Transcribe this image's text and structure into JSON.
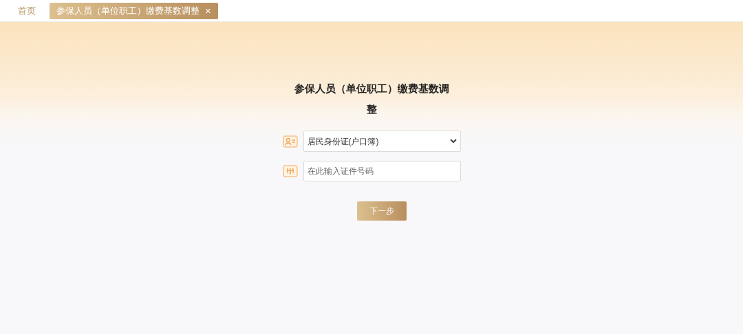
{
  "tabs": [
    {
      "label": "首页",
      "selected": false,
      "closable": false
    },
    {
      "label": "参保人员（单位职工）缴费基数调整",
      "selected": true,
      "closable": true
    }
  ],
  "close_symbol": "×",
  "form": {
    "title": "参保人员（单位职工）缴费基数调整",
    "id_type": {
      "value": "居民身份证(户口簿)"
    },
    "id_number": {
      "placeholder": "在此输入证件号码"
    },
    "submit": "下一步"
  }
}
